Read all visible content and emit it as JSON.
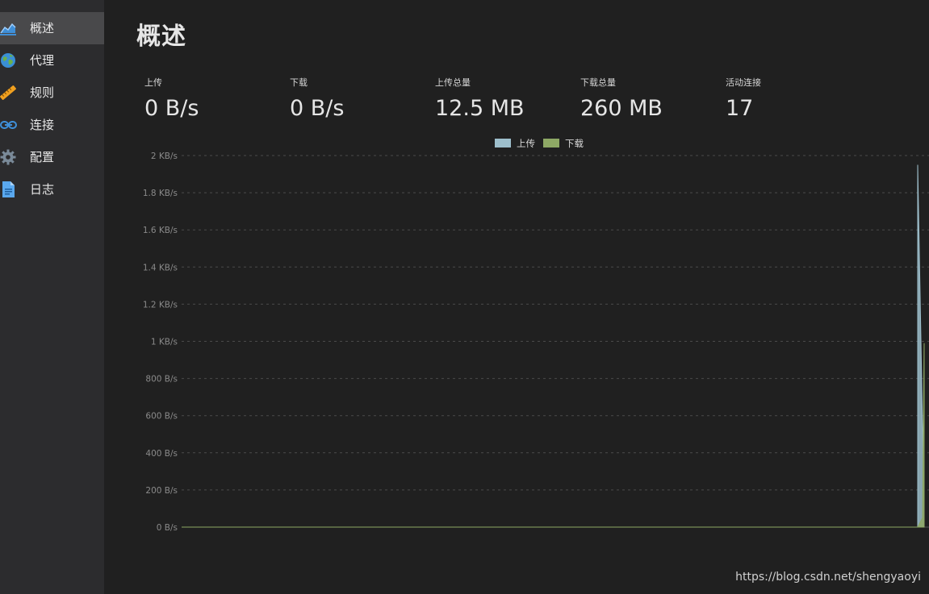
{
  "sidebar": {
    "items": [
      {
        "label": "概述",
        "icon": "chart-area-icon",
        "active": true
      },
      {
        "label": "代理",
        "icon": "globe-icon",
        "active": false
      },
      {
        "label": "规则",
        "icon": "ruler-icon",
        "active": false
      },
      {
        "label": "连接",
        "icon": "link-icon",
        "active": false
      },
      {
        "label": "配置",
        "icon": "gear-icon",
        "active": false
      },
      {
        "label": "日志",
        "icon": "document-icon",
        "active": false
      }
    ]
  },
  "page": {
    "title": "概述"
  },
  "stats": [
    {
      "label": "上传",
      "value": "0 B/s"
    },
    {
      "label": "下载",
      "value": "0 B/s"
    },
    {
      "label": "上传总量",
      "value": "12.5 MB"
    },
    {
      "label": "下载总量",
      "value": "260 MB"
    },
    {
      "label": "活动连接",
      "value": "17"
    }
  ],
  "chart_data": {
    "type": "area",
    "legend_position": "top-center",
    "grid": true,
    "ylim": [
      0,
      2000
    ],
    "y_ticks": [
      "0 B/s",
      "200 B/s",
      "400 B/s",
      "600 B/s",
      "800 B/s",
      "1 KB/s",
      "1.2 KB/s",
      "1.4 KB/s",
      "1.6 KB/s",
      "1.8 KB/s",
      "2 KB/s"
    ],
    "series": [
      {
        "name": "上传",
        "color": "#9ebfcc",
        "values": [
          0,
          0,
          0,
          0,
          0,
          0,
          0,
          0,
          0,
          0,
          0,
          0,
          0,
          0,
          0,
          0,
          0,
          0,
          0,
          0,
          0,
          0,
          0,
          0,
          0,
          0,
          0,
          0,
          1950,
          60
        ]
      },
      {
        "name": "下载",
        "color": "#8ea865",
        "values": [
          0,
          0,
          0,
          0,
          0,
          0,
          0,
          0,
          0,
          0,
          0,
          0,
          0,
          0,
          0,
          0,
          0,
          0,
          0,
          0,
          0,
          0,
          0,
          0,
          0,
          0,
          0,
          0,
          50,
          990
        ]
      }
    ]
  },
  "watermark": "https://blog.csdn.net/shengyaoyi"
}
